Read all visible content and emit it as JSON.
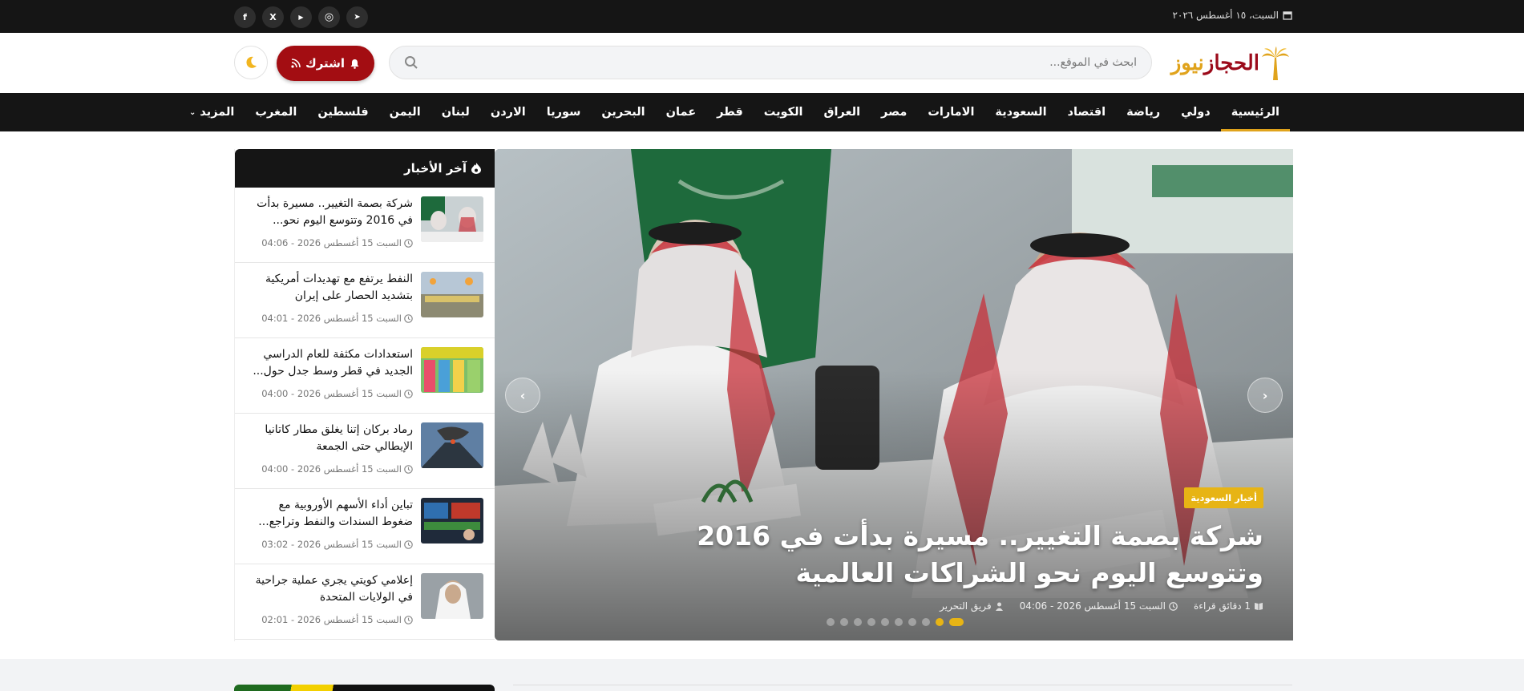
{
  "topbar": {
    "date": "السبت، ١٥ أغسطس ٢٠٢٦",
    "socials": [
      {
        "name": "telegram-icon",
        "glyph": "➤"
      },
      {
        "name": "instagram-icon",
        "glyph": "◎"
      },
      {
        "name": "youtube-icon",
        "glyph": "▶"
      },
      {
        "name": "x-icon",
        "glyph": "X"
      },
      {
        "name": "facebook-icon",
        "glyph": "f"
      }
    ]
  },
  "header": {
    "logo": {
      "part1": "الحجاز",
      "part2": "نيوز"
    },
    "search_placeholder": "ابحث في الموقع...",
    "subscribe_label": "اشترك"
  },
  "nav": {
    "items": [
      "الرئيسية",
      "دولي",
      "رياضة",
      "اقتصاد",
      "السعودية",
      "الامارات",
      "مصر",
      "العراق",
      "الكويت",
      "قطر",
      "عمان",
      "البحرين",
      "سوريا",
      "الاردن",
      "لبنان",
      "اليمن",
      "فلسطين",
      "المغرب",
      "المزيد"
    ],
    "active": "الرئيسية"
  },
  "slider": {
    "category": "أخبار السعودية",
    "title": "شركة بصمة التغيير.. مسيرة بدأت في 2016 وتتوسع اليوم نحو الشراكات العالمية",
    "author": "فريق التحرير",
    "date": "السبت 15 أغسطس 2026 - 04:06",
    "read_time": "1 دقائق قراءة"
  },
  "latest": {
    "heading": "آخر الأخبار",
    "items": [
      {
        "title": "شركة بصمة التغيير.. مسيرة بدأت في 2016 وتتوسع اليوم نحو...",
        "time": "السبت 15 أغسطس 2026 - 04:06"
      },
      {
        "title": "النفط يرتفع مع تهديدات أمريكية بتشديد الحصار على إيران",
        "time": "السبت 15 أغسطس 2026 - 04:01"
      },
      {
        "title": "استعدادات مكثفة للعام الدراسي الجديد في قطر وسط جدل حول...",
        "time": "السبت 15 أغسطس 2026 - 04:00"
      },
      {
        "title": "رماد بركان إتنا يغلق مطار كاتانيا الإيطالي حتى الجمعة",
        "time": "السبت 15 أغسطس 2026 - 04:00"
      },
      {
        "title": "تباين أداء الأسهم الأوروبية مع ضغوط السندات والنفط وتراجع...",
        "time": "السبت 15 أغسطس 2026 - 03:02"
      },
      {
        "title": "إعلامي كويتي يجري عملية جراحية في الولايات المتحدة",
        "time": "السبت 15 أغسطس 2026 - 02:01"
      }
    ]
  },
  "colors": {
    "dark": "#151515",
    "brand_red": "#a30d12",
    "gold": "#e0a31c",
    "badge": "#e7b415"
  }
}
